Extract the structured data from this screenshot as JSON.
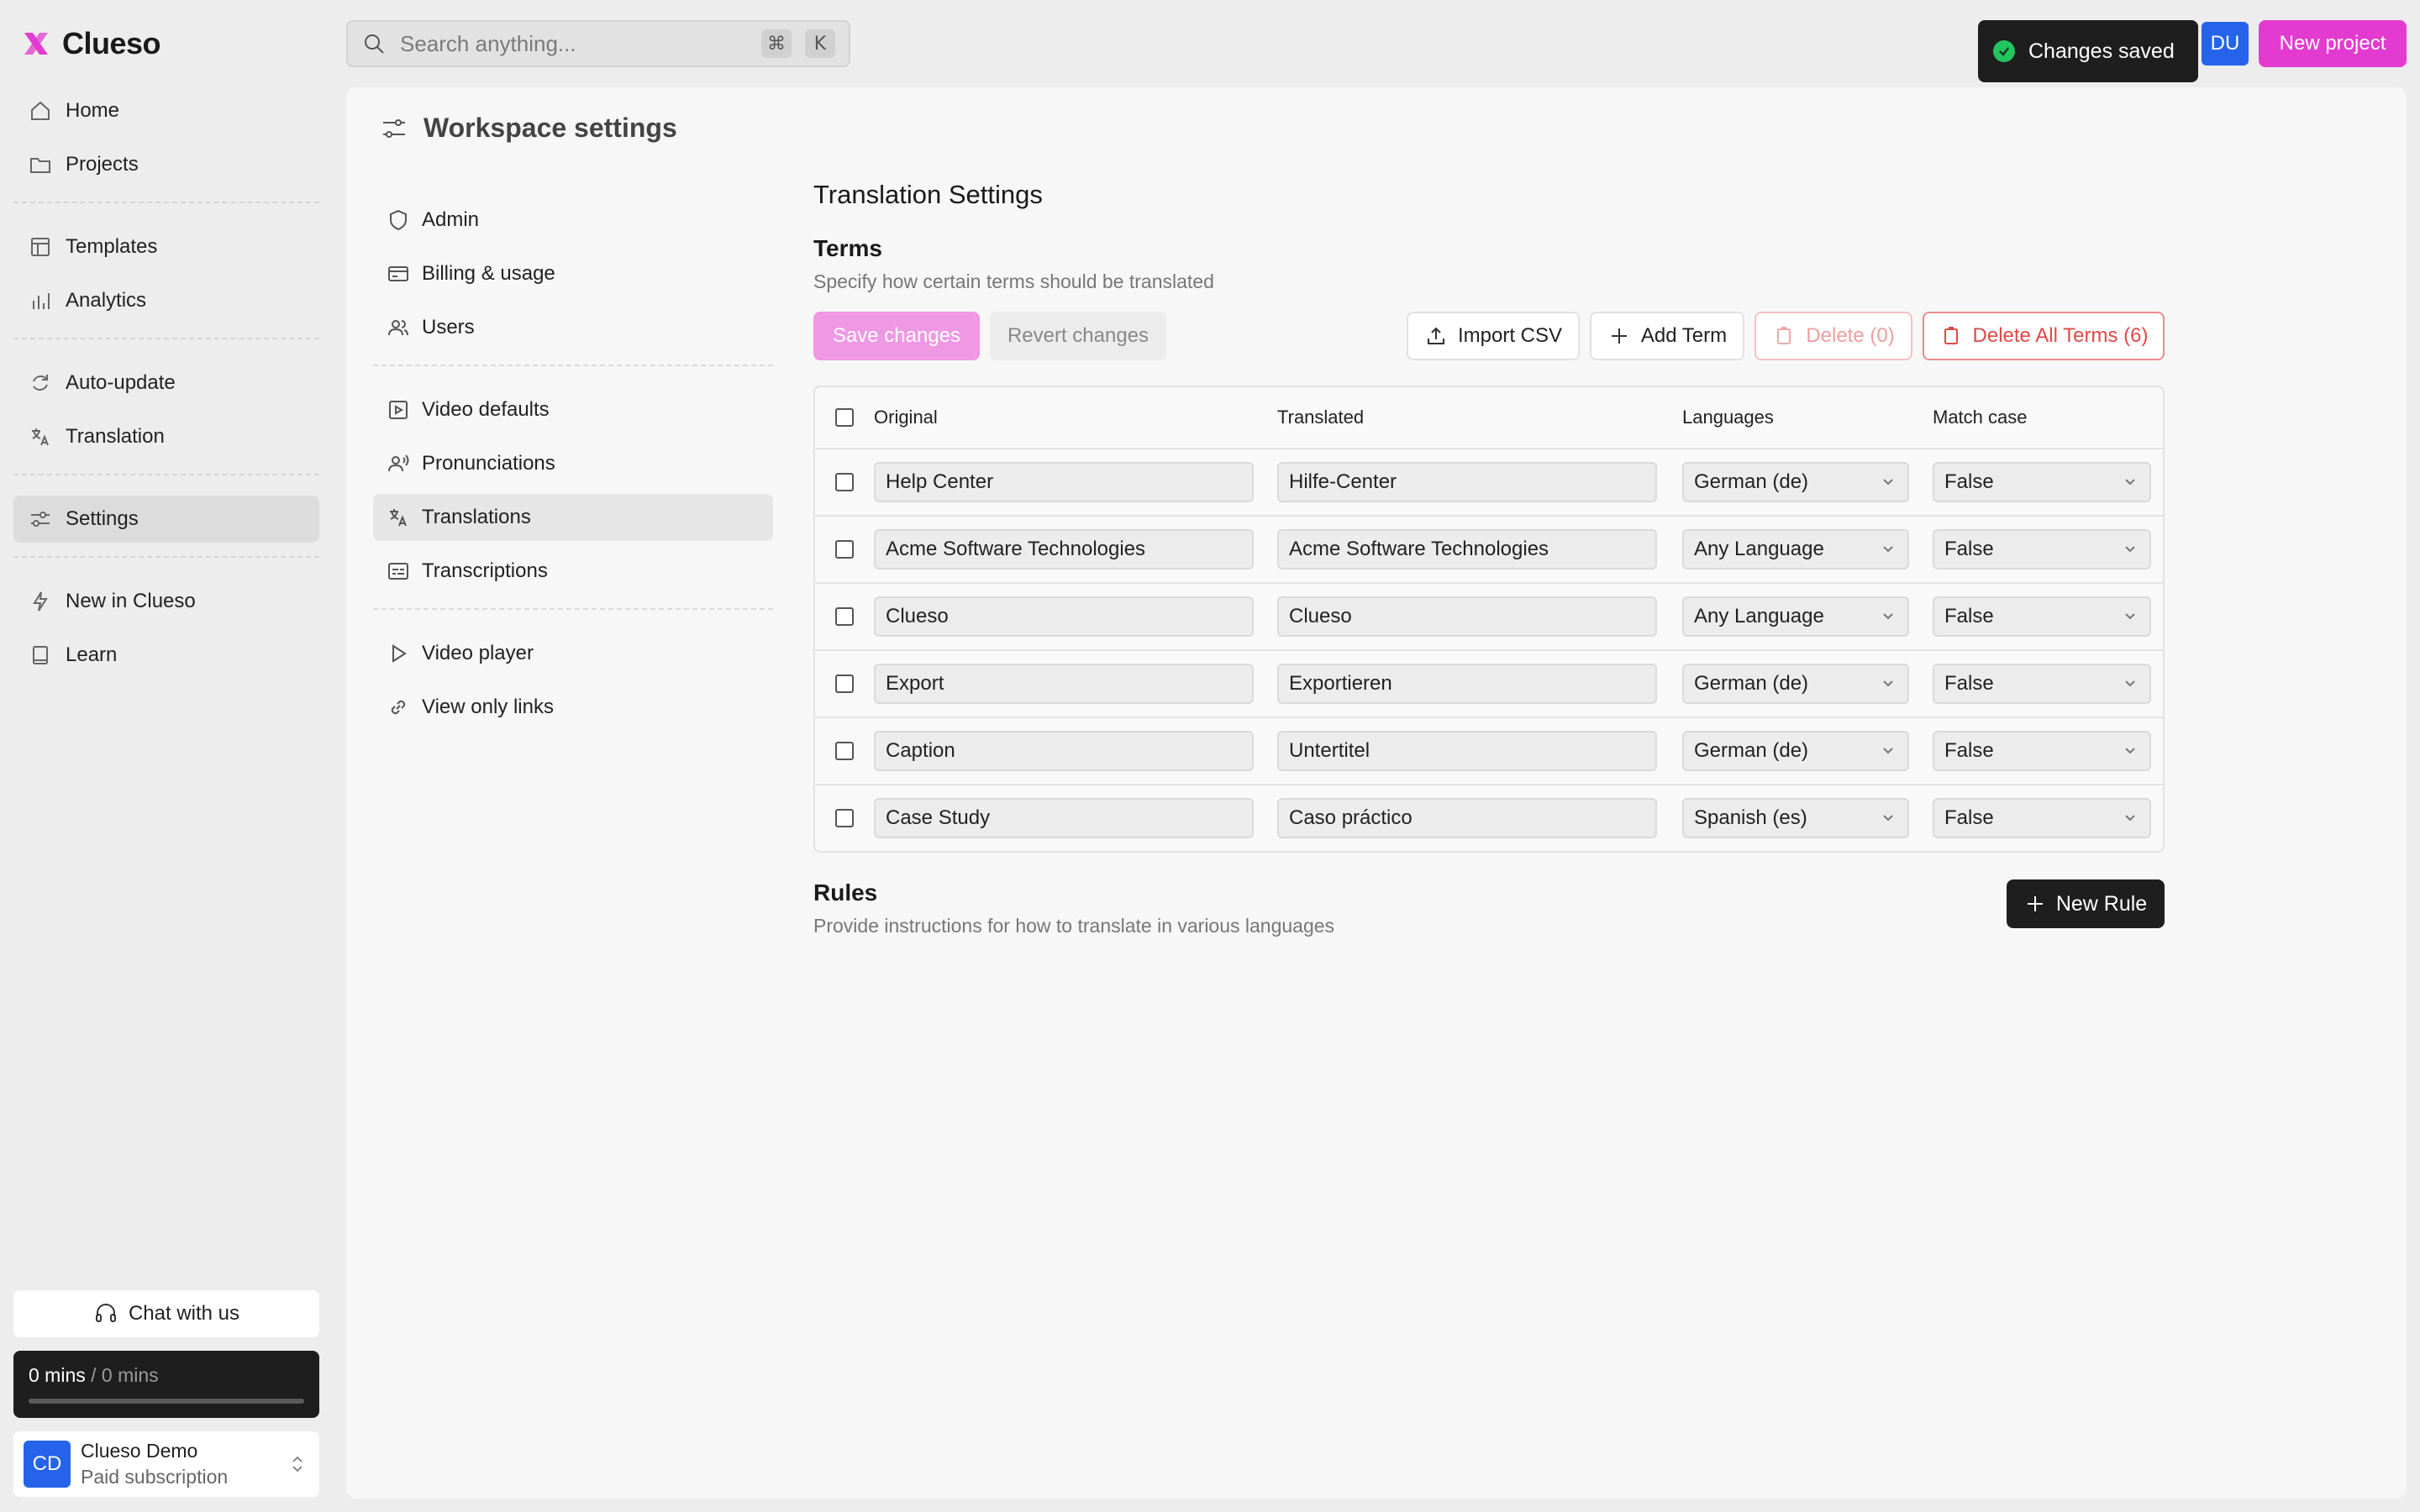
{
  "app": {
    "name": "Clueso"
  },
  "nav": {
    "groups": [
      [
        {
          "label": "Home",
          "icon": "home-icon"
        },
        {
          "label": "Projects",
          "icon": "folder-icon"
        }
      ],
      [
        {
          "label": "Templates",
          "icon": "template-icon"
        },
        {
          "label": "Analytics",
          "icon": "chart-icon"
        }
      ],
      [
        {
          "label": "Auto-update",
          "icon": "refresh-icon"
        },
        {
          "label": "Translation",
          "icon": "translate-icon"
        }
      ],
      [
        {
          "label": "Settings",
          "icon": "sliders-icon",
          "active": true
        }
      ],
      [
        {
          "label": "New in Clueso",
          "icon": "lightning-icon"
        },
        {
          "label": "Learn",
          "icon": "book-icon"
        }
      ]
    ],
    "chat_label": "Chat with us",
    "usage": {
      "used": "0 mins",
      "separator": "/",
      "total": "0 mins",
      "fraction": 0
    },
    "account": {
      "initials": "CD",
      "name": "Clueso Demo",
      "plan": "Paid subscription"
    }
  },
  "topbar": {
    "search_placeholder": "Search anything...",
    "shortcut_key1": "⌘",
    "shortcut_key2": "K",
    "toast": "Changes saved",
    "user_initials": "DU",
    "new_project_label": "New project"
  },
  "page": {
    "title": "Workspace settings",
    "settings_nav": {
      "groups": [
        [
          {
            "label": "Admin"
          },
          {
            "label": "Billing & usage"
          },
          {
            "label": "Users"
          }
        ],
        [
          {
            "label": "Video defaults"
          },
          {
            "label": "Pronunciations"
          },
          {
            "label": "Translations",
            "active": true
          },
          {
            "label": "Transcriptions"
          }
        ],
        [
          {
            "label": "Video player"
          },
          {
            "label": "View only links"
          }
        ]
      ]
    },
    "section_title": "Translation Settings",
    "terms": {
      "title": "Terms",
      "description": "Specify how certain terms should be translated",
      "save_label": "Save changes",
      "revert_label": "Revert changes",
      "import_label": "Import CSV",
      "add_label": "Add Term",
      "delete_label": "Delete (0)",
      "delete_all_label": "Delete All Terms (6)",
      "columns": {
        "original": "Original",
        "translated": "Translated",
        "languages": "Languages",
        "match_case": "Match case"
      },
      "rows": [
        {
          "original": "Help Center",
          "translated": "Hilfe-Center",
          "language": "German (de)",
          "match_case": "False"
        },
        {
          "original": "Acme Software Technologies",
          "translated": "Acme Software Technologies",
          "language": "Any Language",
          "match_case": "False"
        },
        {
          "original": "Clueso",
          "translated": "Clueso",
          "language": "Any Language",
          "match_case": "False"
        },
        {
          "original": "Export",
          "translated": "Exportieren",
          "language": "German (de)",
          "match_case": "False"
        },
        {
          "original": "Caption",
          "translated": "Untertitel",
          "language": "German (de)",
          "match_case": "False"
        },
        {
          "original": "Case Study",
          "translated": "Caso práctico",
          "language": "Spanish (es)",
          "match_case": "False"
        }
      ]
    },
    "rules": {
      "title": "Rules",
      "description": "Provide instructions for how to translate in various languages",
      "new_rule_label": "New Rule"
    }
  },
  "colors": {
    "accent": "#e33bd0",
    "accent_disabled": "#ef98e3",
    "danger": "#e04848",
    "avatar": "#2563eb",
    "success": "#22c55e"
  }
}
